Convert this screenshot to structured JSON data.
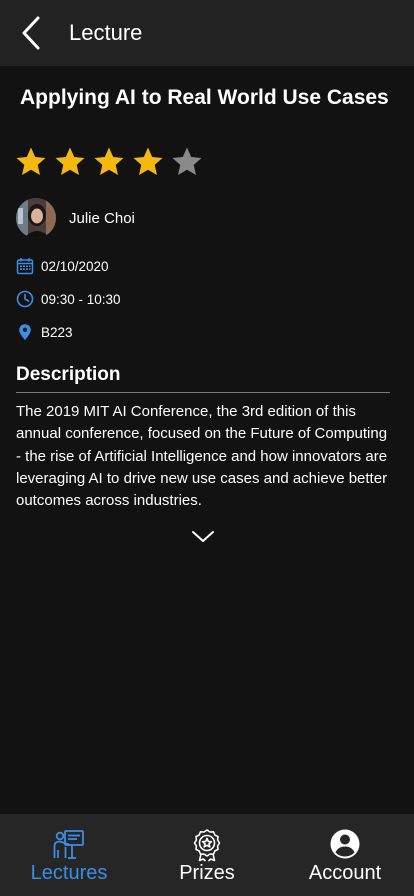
{
  "header": {
    "title": "Lecture"
  },
  "lecture": {
    "title": "Applying AI to Real World Use Cases",
    "rating": 4,
    "rating_max": 5,
    "speaker": "Julie Choi",
    "date": "02/10/2020",
    "time": "09:30 - 10:30",
    "room": "B223"
  },
  "description": {
    "heading": "Description",
    "text": "The 2019 MIT AI Conference, the 3rd edition of this annual conference, focused on the Future of Computing - the rise of Artificial Intelligence and how innovators are leveraging AI to drive new use cases and achieve better outcomes across industries."
  },
  "nav": {
    "items": [
      {
        "label": "Lectures",
        "icon": "lecture-presenter-icon",
        "active": true
      },
      {
        "label": "Prizes",
        "icon": "award-badge-icon",
        "active": false
      },
      {
        "label": "Account",
        "icon": "account-circle-icon",
        "active": false
      }
    ]
  },
  "colors": {
    "accent": "#3a8ee6",
    "star_filled": "#f5b80f",
    "star_empty": "#8a8a8a",
    "background": "#121212",
    "bar": "#222222"
  }
}
